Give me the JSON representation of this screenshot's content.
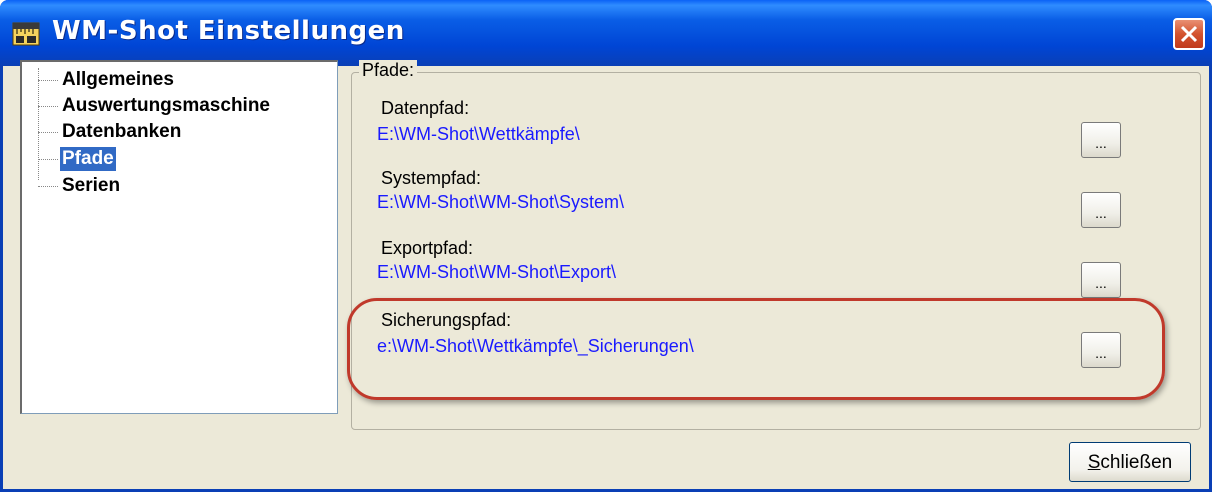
{
  "window": {
    "title": "WM-Shot Einstellungen"
  },
  "tree": {
    "items": [
      {
        "label": "Allgemeines"
      },
      {
        "label": "Auswertungsmaschine"
      },
      {
        "label": "Datenbanken"
      },
      {
        "label": "Pfade",
        "selected": true
      },
      {
        "label": "Serien"
      }
    ]
  },
  "group": {
    "legend": "Pfade:",
    "paths": [
      {
        "label": "Datenpfad:",
        "value": "E:\\WM-Shot\\Wettkämpfe\\",
        "button": "..."
      },
      {
        "label": "Systempfad:",
        "value": "E:\\WM-Shot\\WM-Shot\\System\\",
        "button": "..."
      },
      {
        "label": "Exportpfad:",
        "value": "E:\\WM-Shot\\WM-Shot\\Export\\",
        "button": "..."
      },
      {
        "label": "Sicherungspfad:",
        "value": "e:\\WM-Shot\\Wettkämpfe\\_Sicherungen\\",
        "button": "..."
      }
    ]
  },
  "footer": {
    "close_label_first": "S",
    "close_label_rest": "chließen"
  },
  "colors": {
    "path_value": "#1a1aff",
    "selection": "#316ac5",
    "highlight": "#c0392b",
    "titlebar": "#0a5ee6"
  },
  "icons": {
    "app": "ruler-app-icon",
    "close": "close-x-icon"
  }
}
